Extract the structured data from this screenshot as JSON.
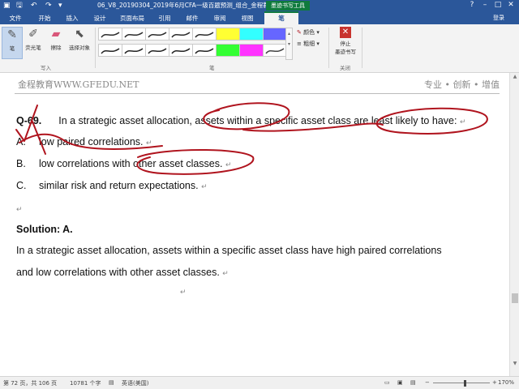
{
  "window": {
    "doc_title": "06_V8_20190304_2019年6月CFA一级百题预测_组合_金程教育...",
    "context_title": "墨迹书写工具",
    "user": "登录"
  },
  "tabs": {
    "file": "文件",
    "home": "开始",
    "insert": "插入",
    "design": "设计",
    "layout": "页面布局",
    "references": "引用",
    "mailings": "邮件",
    "review": "审阅",
    "view": "视图",
    "pens": "笔"
  },
  "ribbon": {
    "pen": "笔",
    "highlighter": "荧光笔",
    "eraser": "擦除",
    "select_objects": "选择对象",
    "color": "颜色",
    "thickness": "粗细",
    "stop_inking_line1": "停止",
    "stop_inking_line2": "墨迹书写",
    "group_write": "写入",
    "group_pens": "笔",
    "group_close": "关闭",
    "pen_colors": [
      "#2b2b2b",
      "#2b2b2b",
      "#2b2b2b",
      "#2b2b2b",
      "#2b2b2b",
      "#ffff33",
      "#33ffff",
      "#6666ff",
      "#222222",
      "#222222",
      "#222222",
      "#222222",
      "#222222",
      "#33ff33",
      "#ff33ff",
      "#444444"
    ]
  },
  "document": {
    "header_left": "金程教育WWW.GFEDU.NET",
    "header_right": "专业 • 创新 • 增值",
    "question_number": "Q-69.",
    "question_text": "In a strategic asset allocation, assets within a specific asset class are least likely to have:",
    "options": [
      {
        "label": "A.",
        "text": "low paired correlations."
      },
      {
        "label": "B.",
        "text": "low correlations with other asset classes."
      },
      {
        "label": "C.",
        "text": "similar risk and return expectations."
      }
    ],
    "solution_label": "Solution: A.",
    "solution_line1": "In a strategic asset allocation, assets within a specific asset class have high paired correlations",
    "solution_line2": "and low correlations with other asset classes.",
    "paragraph_mark": "↵",
    "ink_color": "#b0141e"
  },
  "status": {
    "page": "第 72 页，共 106 页",
    "words": "10781 个字",
    "language": "英语(美国)",
    "zoom": "170%",
    "zoom_minus": "−",
    "zoom_plus": "+"
  }
}
